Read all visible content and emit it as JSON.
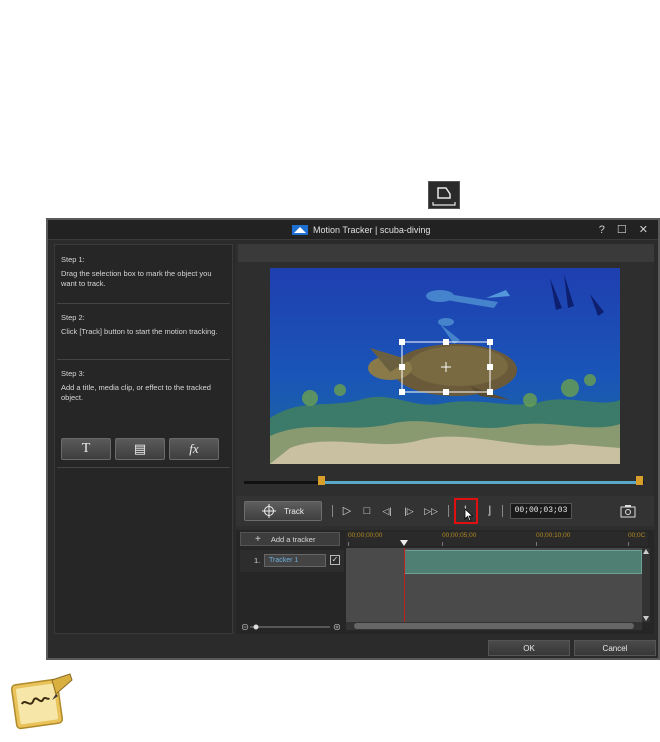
{
  "window": {
    "title": "Motion Tracker | scuba-diving",
    "help": "?",
    "maximize": "☐",
    "close": "✕"
  },
  "steps": [
    {
      "heading": "Step 1:",
      "text": "Drag the selection box to mark the object you want to track."
    },
    {
      "heading": "Step 2:",
      "text": "Click [Track] button to start the motion tracking."
    },
    {
      "heading": "Step 3:",
      "text": "Add a title, media clip, or effect to the tracked object."
    }
  ],
  "tools": {
    "title_glyph": "T",
    "media_glyph": "▤",
    "fx_glyph": "fx"
  },
  "controls": {
    "track_label": "Track",
    "timecode": "00;00;03;03",
    "play": "▷",
    "stop": "□",
    "prev_frame": "◁|",
    "next_frame": "|▷",
    "fast_forward": "▷▷",
    "mark_in": "⌊",
    "mark_out": "⌋"
  },
  "timeline": {
    "add_tracker_label": "Add a tracker",
    "add_icon": "+",
    "ruler": [
      "00;00;00;00",
      "00;00;05;00",
      "00;00;10;00",
      "00;0C"
    ],
    "tracker_number": "1.",
    "tracker_name": "Tracker 1",
    "checked": "✓"
  },
  "footer": {
    "ok": "OK",
    "cancel": "Cancel"
  },
  "colors": {
    "accent": "#5aa8c8",
    "handle": "#d8a02a",
    "highlight": "#e01010",
    "clip": "#4f7f72"
  }
}
